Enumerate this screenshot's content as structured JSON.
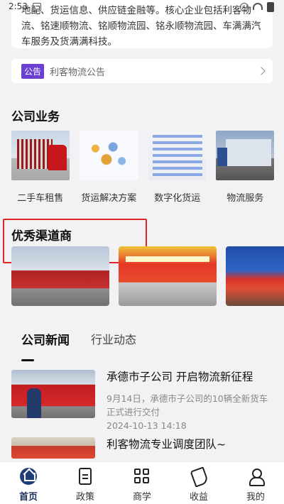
{
  "status_bar": {
    "time": "2:53"
  },
  "intro": {
    "text": "地配、货运信息、供应链金融等。核心企业包括利客物流、铭速顺物流、铭顺物流园、铭永顺物流园、车满满汽车服务及货满满科技。"
  },
  "notice": {
    "tag": "公告",
    "text": "利客物流公告"
  },
  "business": {
    "title": "公司业务",
    "items": [
      {
        "label": "二手车租售"
      },
      {
        "label": "货运解决方案"
      },
      {
        "label": "数字化货运"
      },
      {
        "label": "物流服务"
      }
    ]
  },
  "channel": {
    "title": "优秀渠道商"
  },
  "news": {
    "tabs": [
      {
        "label": "公司新闻",
        "active": true
      },
      {
        "label": "行业动态",
        "active": false
      }
    ],
    "items": [
      {
        "title": "承德市子公司  开启物流新征程",
        "desc": "9月14日，承德市子公司的10辆全新货车正式进行交付",
        "date": "2024-10-13 14:18"
      },
      {
        "title": "利客物流专业调度团队~"
      }
    ]
  },
  "bottom_nav": [
    {
      "label": "首页",
      "icon": "home-icon",
      "active": true
    },
    {
      "label": "政策",
      "icon": "document-icon",
      "active": false
    },
    {
      "label": "商学",
      "icon": "grid-icon",
      "active": false
    },
    {
      "label": "收益",
      "icon": "phone-icon",
      "active": false
    },
    {
      "label": "我的",
      "icon": "user-icon",
      "active": false
    }
  ],
  "colors": {
    "accent": "#6b3fd1",
    "nav_active": "#1f3e78",
    "highlight": "#e02525"
  }
}
